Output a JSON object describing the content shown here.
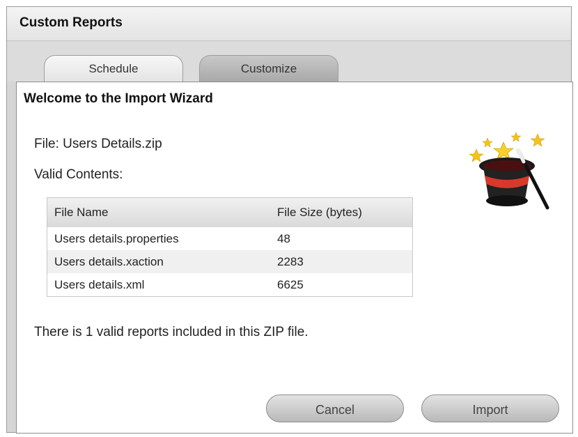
{
  "window": {
    "title": "Custom Reports"
  },
  "tabs": [
    {
      "label": "Schedule"
    },
    {
      "label": "Customize"
    }
  ],
  "wizard": {
    "heading": "Welcome to the Import Wizard",
    "file_line": "File: Users Details.zip",
    "valid_contents_label": "Valid Contents:",
    "table": {
      "headers": [
        "File Name",
        "File Size (bytes)"
      ],
      "rows": [
        {
          "name": "Users details.properties",
          "size": "48"
        },
        {
          "name": "Users details.xaction",
          "size": "2283"
        },
        {
          "name": "Users details.xml",
          "size": "6625"
        }
      ]
    },
    "summary": "There is 1 valid reports included in this ZIP file."
  },
  "buttons": {
    "cancel": "Cancel",
    "import": "Import"
  },
  "icons": {
    "wizard": "magic-hat-wand-icon"
  },
  "colors": {
    "hat_band": "#d8392a",
    "star": "#f5c21b"
  }
}
